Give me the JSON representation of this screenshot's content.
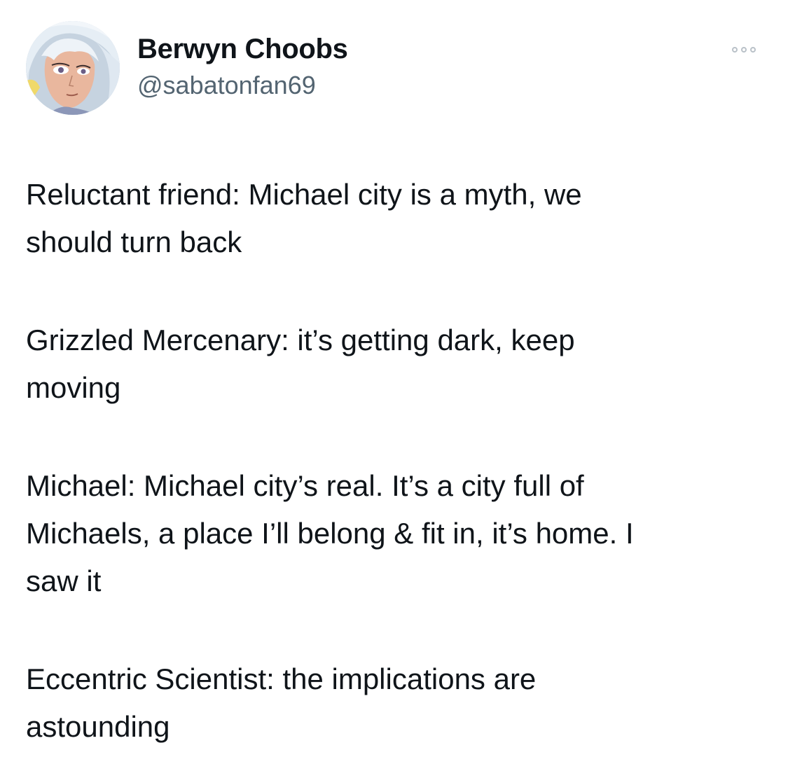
{
  "author": {
    "display_name": "Berwyn Choobs",
    "handle": "@sabatonfan69",
    "avatar_icon": "anime-character-avatar"
  },
  "menu": {
    "icon": "more-options-icon"
  },
  "tweet": {
    "paragraphs": [
      "Reluctant friend: Michael city is a myth, we\nshould turn back",
      "Grizzled Mercenary: it’s getting dark, keep\nmoving",
      "Michael: Michael city’s real. It’s a city full of\nMichaels, a place I’ll belong & fit in, it’s home. I\nsaw it",
      "Eccentric Scientist: the implications are\nastounding"
    ]
  },
  "colors": {
    "text_primary": "#0f1419",
    "text_secondary": "#536471",
    "dots": "#b9c1c8"
  }
}
